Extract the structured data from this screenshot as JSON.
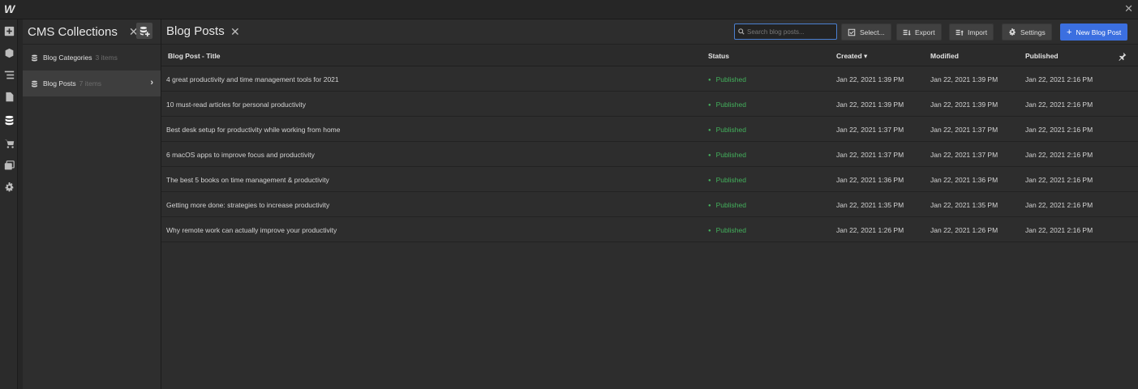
{
  "app": {
    "logo": "W"
  },
  "collections": {
    "title": "CMS Collections",
    "close_label": "✕",
    "items": [
      {
        "label": "Blog Categories",
        "count": "3 items"
      },
      {
        "label": "Blog Posts",
        "count": "7 items"
      }
    ]
  },
  "main": {
    "title": "Blog Posts",
    "close_label": "✕",
    "search_placeholder": "Search blog posts...",
    "buttons": {
      "select": "Select...",
      "export": "Export",
      "import": "Import",
      "settings": "Settings",
      "new_post": "New Blog Post"
    }
  },
  "table": {
    "headers": {
      "title": "Blog Post - Title",
      "status": "Status",
      "created": "Created ▾",
      "modified": "Modified",
      "published": "Published"
    },
    "rows": [
      {
        "title": "4 great productivity and time management tools for 2021",
        "status": "Published",
        "created": "Jan 22, 2021 1:39 PM",
        "modified": "Jan 22, 2021 1:39 PM",
        "published": "Jan 22, 2021 2:16 PM"
      },
      {
        "title": "10 must-read articles for personal productivity",
        "status": "Published",
        "created": "Jan 22, 2021 1:39 PM",
        "modified": "Jan 22, 2021 1:39 PM",
        "published": "Jan 22, 2021 2:16 PM"
      },
      {
        "title": "Best desk setup for productivity while working from home",
        "status": "Published",
        "created": "Jan 22, 2021 1:37 PM",
        "modified": "Jan 22, 2021 1:37 PM",
        "published": "Jan 22, 2021 2:16 PM"
      },
      {
        "title": "6 macOS apps to improve focus and productivity",
        "status": "Published",
        "created": "Jan 22, 2021 1:37 PM",
        "modified": "Jan 22, 2021 1:37 PM",
        "published": "Jan 22, 2021 2:16 PM"
      },
      {
        "title": "The best 5 books on time management & productivity",
        "status": "Published",
        "created": "Jan 22, 2021 1:36 PM",
        "modified": "Jan 22, 2021 1:36 PM",
        "published": "Jan 22, 2021 2:16 PM"
      },
      {
        "title": "Getting more done: strategies to increase productivity",
        "status": "Published",
        "created": "Jan 22, 2021 1:35 PM",
        "modified": "Jan 22, 2021 1:35 PM",
        "published": "Jan 22, 2021 2:16 PM"
      },
      {
        "title": "Why remote work can actually improve your productivity",
        "status": "Published",
        "created": "Jan 22, 2021 1:26 PM",
        "modified": "Jan 22, 2021 1:26 PM",
        "published": "Jan 22, 2021 2:16 PM"
      }
    ]
  },
  "colors": {
    "accent": "#3b6fe0",
    "status_published": "#43b05c"
  }
}
